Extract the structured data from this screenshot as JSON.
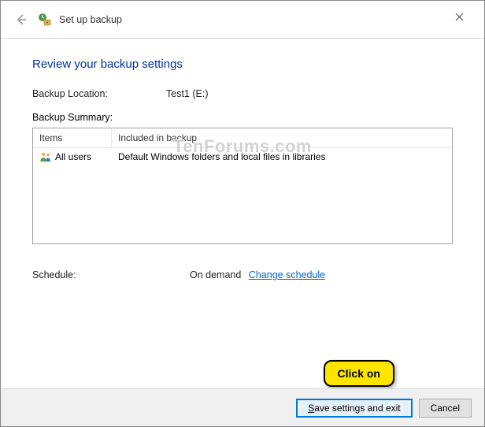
{
  "titlebar": {
    "title": "Set up backup"
  },
  "heading": "Review your backup settings",
  "location": {
    "label": "Backup Location:",
    "value": "Test1 (E:)"
  },
  "summary": {
    "label": "Backup Summary:",
    "columns": {
      "items": "Items",
      "included": "Included in backup"
    },
    "rows": [
      {
        "items": "All users",
        "included": "Default Windows folders and local files in libraries"
      }
    ]
  },
  "schedule": {
    "label": "Schedule:",
    "value": "On demand",
    "change_link": "Change schedule"
  },
  "footer": {
    "save": "Save settings and exit",
    "cancel": "Cancel"
  },
  "callout": "Click on",
  "watermark": "TenForums.com"
}
